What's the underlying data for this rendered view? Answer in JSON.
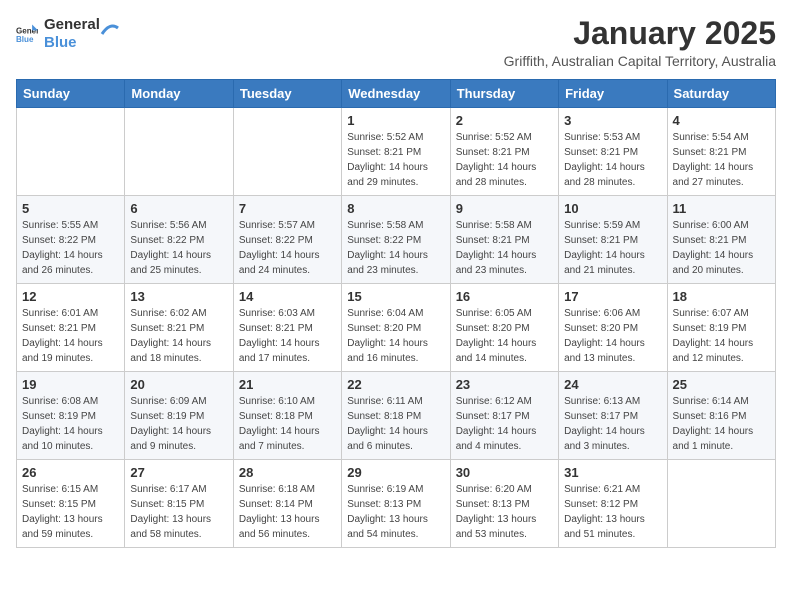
{
  "header": {
    "logo_general": "General",
    "logo_blue": "Blue",
    "title": "January 2025",
    "subtitle": "Griffith, Australian Capital Territory, Australia"
  },
  "weekdays": [
    "Sunday",
    "Monday",
    "Tuesday",
    "Wednesday",
    "Thursday",
    "Friday",
    "Saturday"
  ],
  "weeks": [
    [
      {
        "day": "",
        "info": ""
      },
      {
        "day": "",
        "info": ""
      },
      {
        "day": "",
        "info": ""
      },
      {
        "day": "1",
        "info": "Sunrise: 5:52 AM\nSunset: 8:21 PM\nDaylight: 14 hours\nand 29 minutes."
      },
      {
        "day": "2",
        "info": "Sunrise: 5:52 AM\nSunset: 8:21 PM\nDaylight: 14 hours\nand 28 minutes."
      },
      {
        "day": "3",
        "info": "Sunrise: 5:53 AM\nSunset: 8:21 PM\nDaylight: 14 hours\nand 28 minutes."
      },
      {
        "day": "4",
        "info": "Sunrise: 5:54 AM\nSunset: 8:21 PM\nDaylight: 14 hours\nand 27 minutes."
      }
    ],
    [
      {
        "day": "5",
        "info": "Sunrise: 5:55 AM\nSunset: 8:22 PM\nDaylight: 14 hours\nand 26 minutes."
      },
      {
        "day": "6",
        "info": "Sunrise: 5:56 AM\nSunset: 8:22 PM\nDaylight: 14 hours\nand 25 minutes."
      },
      {
        "day": "7",
        "info": "Sunrise: 5:57 AM\nSunset: 8:22 PM\nDaylight: 14 hours\nand 24 minutes."
      },
      {
        "day": "8",
        "info": "Sunrise: 5:58 AM\nSunset: 8:22 PM\nDaylight: 14 hours\nand 23 minutes."
      },
      {
        "day": "9",
        "info": "Sunrise: 5:58 AM\nSunset: 8:21 PM\nDaylight: 14 hours\nand 23 minutes."
      },
      {
        "day": "10",
        "info": "Sunrise: 5:59 AM\nSunset: 8:21 PM\nDaylight: 14 hours\nand 21 minutes."
      },
      {
        "day": "11",
        "info": "Sunrise: 6:00 AM\nSunset: 8:21 PM\nDaylight: 14 hours\nand 20 minutes."
      }
    ],
    [
      {
        "day": "12",
        "info": "Sunrise: 6:01 AM\nSunset: 8:21 PM\nDaylight: 14 hours\nand 19 minutes."
      },
      {
        "day": "13",
        "info": "Sunrise: 6:02 AM\nSunset: 8:21 PM\nDaylight: 14 hours\nand 18 minutes."
      },
      {
        "day": "14",
        "info": "Sunrise: 6:03 AM\nSunset: 8:21 PM\nDaylight: 14 hours\nand 17 minutes."
      },
      {
        "day": "15",
        "info": "Sunrise: 6:04 AM\nSunset: 8:20 PM\nDaylight: 14 hours\nand 16 minutes."
      },
      {
        "day": "16",
        "info": "Sunrise: 6:05 AM\nSunset: 8:20 PM\nDaylight: 14 hours\nand 14 minutes."
      },
      {
        "day": "17",
        "info": "Sunrise: 6:06 AM\nSunset: 8:20 PM\nDaylight: 14 hours\nand 13 minutes."
      },
      {
        "day": "18",
        "info": "Sunrise: 6:07 AM\nSunset: 8:19 PM\nDaylight: 14 hours\nand 12 minutes."
      }
    ],
    [
      {
        "day": "19",
        "info": "Sunrise: 6:08 AM\nSunset: 8:19 PM\nDaylight: 14 hours\nand 10 minutes."
      },
      {
        "day": "20",
        "info": "Sunrise: 6:09 AM\nSunset: 8:19 PM\nDaylight: 14 hours\nand 9 minutes."
      },
      {
        "day": "21",
        "info": "Sunrise: 6:10 AM\nSunset: 8:18 PM\nDaylight: 14 hours\nand 7 minutes."
      },
      {
        "day": "22",
        "info": "Sunrise: 6:11 AM\nSunset: 8:18 PM\nDaylight: 14 hours\nand 6 minutes."
      },
      {
        "day": "23",
        "info": "Sunrise: 6:12 AM\nSunset: 8:17 PM\nDaylight: 14 hours\nand 4 minutes."
      },
      {
        "day": "24",
        "info": "Sunrise: 6:13 AM\nSunset: 8:17 PM\nDaylight: 14 hours\nand 3 minutes."
      },
      {
        "day": "25",
        "info": "Sunrise: 6:14 AM\nSunset: 8:16 PM\nDaylight: 14 hours\nand 1 minute."
      }
    ],
    [
      {
        "day": "26",
        "info": "Sunrise: 6:15 AM\nSunset: 8:15 PM\nDaylight: 13 hours\nand 59 minutes."
      },
      {
        "day": "27",
        "info": "Sunrise: 6:17 AM\nSunset: 8:15 PM\nDaylight: 13 hours\nand 58 minutes."
      },
      {
        "day": "28",
        "info": "Sunrise: 6:18 AM\nSunset: 8:14 PM\nDaylight: 13 hours\nand 56 minutes."
      },
      {
        "day": "29",
        "info": "Sunrise: 6:19 AM\nSunset: 8:13 PM\nDaylight: 13 hours\nand 54 minutes."
      },
      {
        "day": "30",
        "info": "Sunrise: 6:20 AM\nSunset: 8:13 PM\nDaylight: 13 hours\nand 53 minutes."
      },
      {
        "day": "31",
        "info": "Sunrise: 6:21 AM\nSunset: 8:12 PM\nDaylight: 13 hours\nand 51 minutes."
      },
      {
        "day": "",
        "info": ""
      }
    ]
  ]
}
